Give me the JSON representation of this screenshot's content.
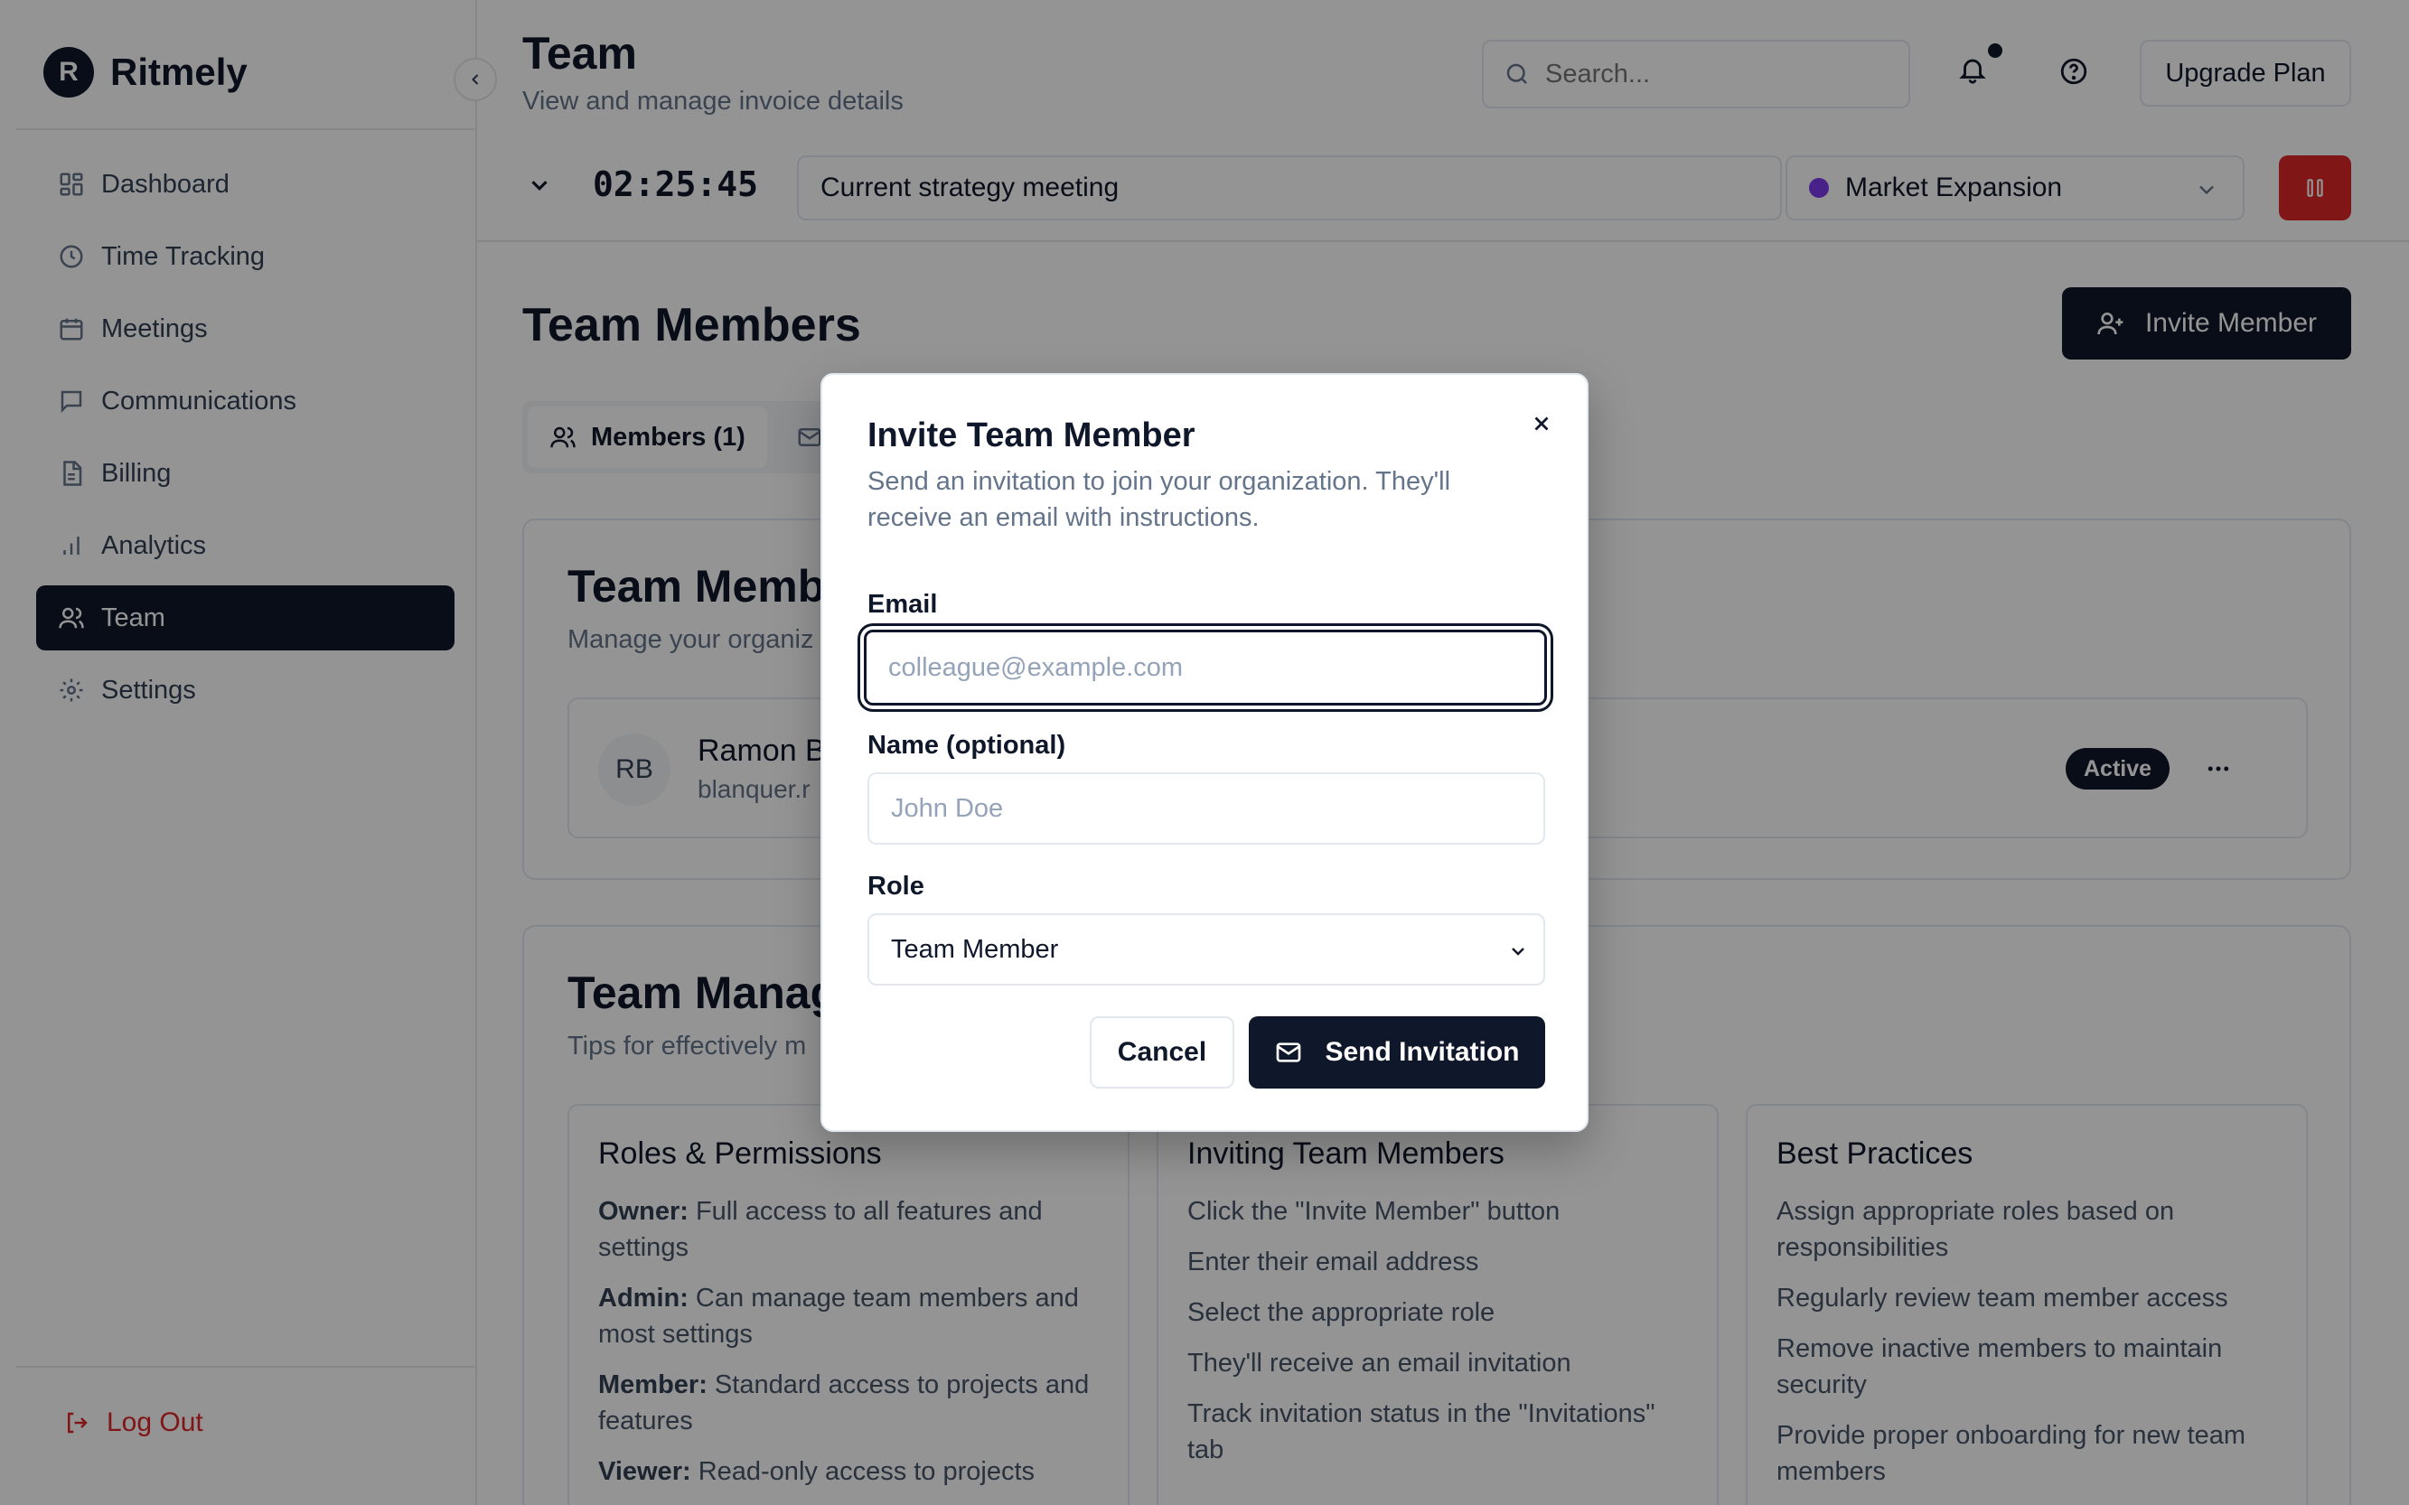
{
  "app": {
    "logo_letter": "R",
    "name": "Ritmely"
  },
  "sidebar": {
    "items": [
      {
        "label": "Dashboard",
        "icon": "dashboard-icon"
      },
      {
        "label": "Time Tracking",
        "icon": "clock-icon"
      },
      {
        "label": "Meetings",
        "icon": "calendar-icon"
      },
      {
        "label": "Communications",
        "icon": "message-icon"
      },
      {
        "label": "Billing",
        "icon": "document-icon"
      },
      {
        "label": "Analytics",
        "icon": "bar-chart-icon"
      },
      {
        "label": "Team",
        "icon": "users-icon",
        "active": true
      },
      {
        "label": "Settings",
        "icon": "gear-icon"
      }
    ],
    "logout_label": "Log Out"
  },
  "header": {
    "title": "Team",
    "subtitle": "View and manage invoice details",
    "search_placeholder": "Search...",
    "upgrade_label": "Upgrade Plan"
  },
  "timer": {
    "elapsed": "02:25:45",
    "description": "Current strategy meeting",
    "project": "Market Expansion",
    "project_color": "#7c3aed",
    "stop_color": "#dc2626"
  },
  "main": {
    "section_title": "Team Members",
    "invite_button_label": "Invite Member",
    "tabs": [
      {
        "label": "Members (1)",
        "active": true
      }
    ],
    "members_card": {
      "title": "Team Members",
      "description": "Manage your organiz",
      "members": [
        {
          "initials": "RB",
          "name": "Ramon B",
          "email": "blanquer.r",
          "status": "Active"
        }
      ]
    },
    "management_card": {
      "title": "Team Manag",
      "description": "Tips for effectively m",
      "sections": [
        {
          "title": "Roles & Permissions",
          "items": [
            {
              "bold": "Owner:",
              "text": " Full access to all features and settings"
            },
            {
              "bold": "Admin:",
              "text": " Can manage team members and most settings"
            },
            {
              "bold": "Member:",
              "text": " Standard access to projects and features"
            },
            {
              "bold": "Viewer:",
              "text": " Read-only access to projects"
            }
          ]
        },
        {
          "title": "Inviting Team Members",
          "items": [
            {
              "bold": "",
              "text": "Click the \"Invite Member\" button"
            },
            {
              "bold": "",
              "text": "Enter their email address"
            },
            {
              "bold": "",
              "text": "Select the appropriate role"
            },
            {
              "bold": "",
              "text": "They'll receive an email invitation"
            },
            {
              "bold": "",
              "text": "Track invitation status in the \"Invitations\" tab"
            }
          ]
        },
        {
          "title": "Best Practices",
          "items": [
            {
              "bold": "",
              "text": "Assign appropriate roles based on responsibilities"
            },
            {
              "bold": "",
              "text": "Regularly review team member access"
            },
            {
              "bold": "",
              "text": "Remove inactive members to maintain security"
            },
            {
              "bold": "",
              "text": "Provide proper onboarding for new team members"
            }
          ]
        }
      ]
    }
  },
  "modal": {
    "title": "Invite Team Member",
    "description": "Send an invitation to join your organization. They'll receive an email with instructions.",
    "email_label": "Email",
    "email_placeholder": "colleague@example.com",
    "email_value": "",
    "name_label": "Name (optional)",
    "name_placeholder": "John Doe",
    "name_value": "",
    "role_label": "Role",
    "role_value": "Team Member",
    "cancel_label": "Cancel",
    "send_label": "Send Invitation"
  },
  "colors": {
    "primary": "#0f172a",
    "danger": "#dc2626",
    "muted_text": "#64748b",
    "border": "#e2e8f0"
  }
}
